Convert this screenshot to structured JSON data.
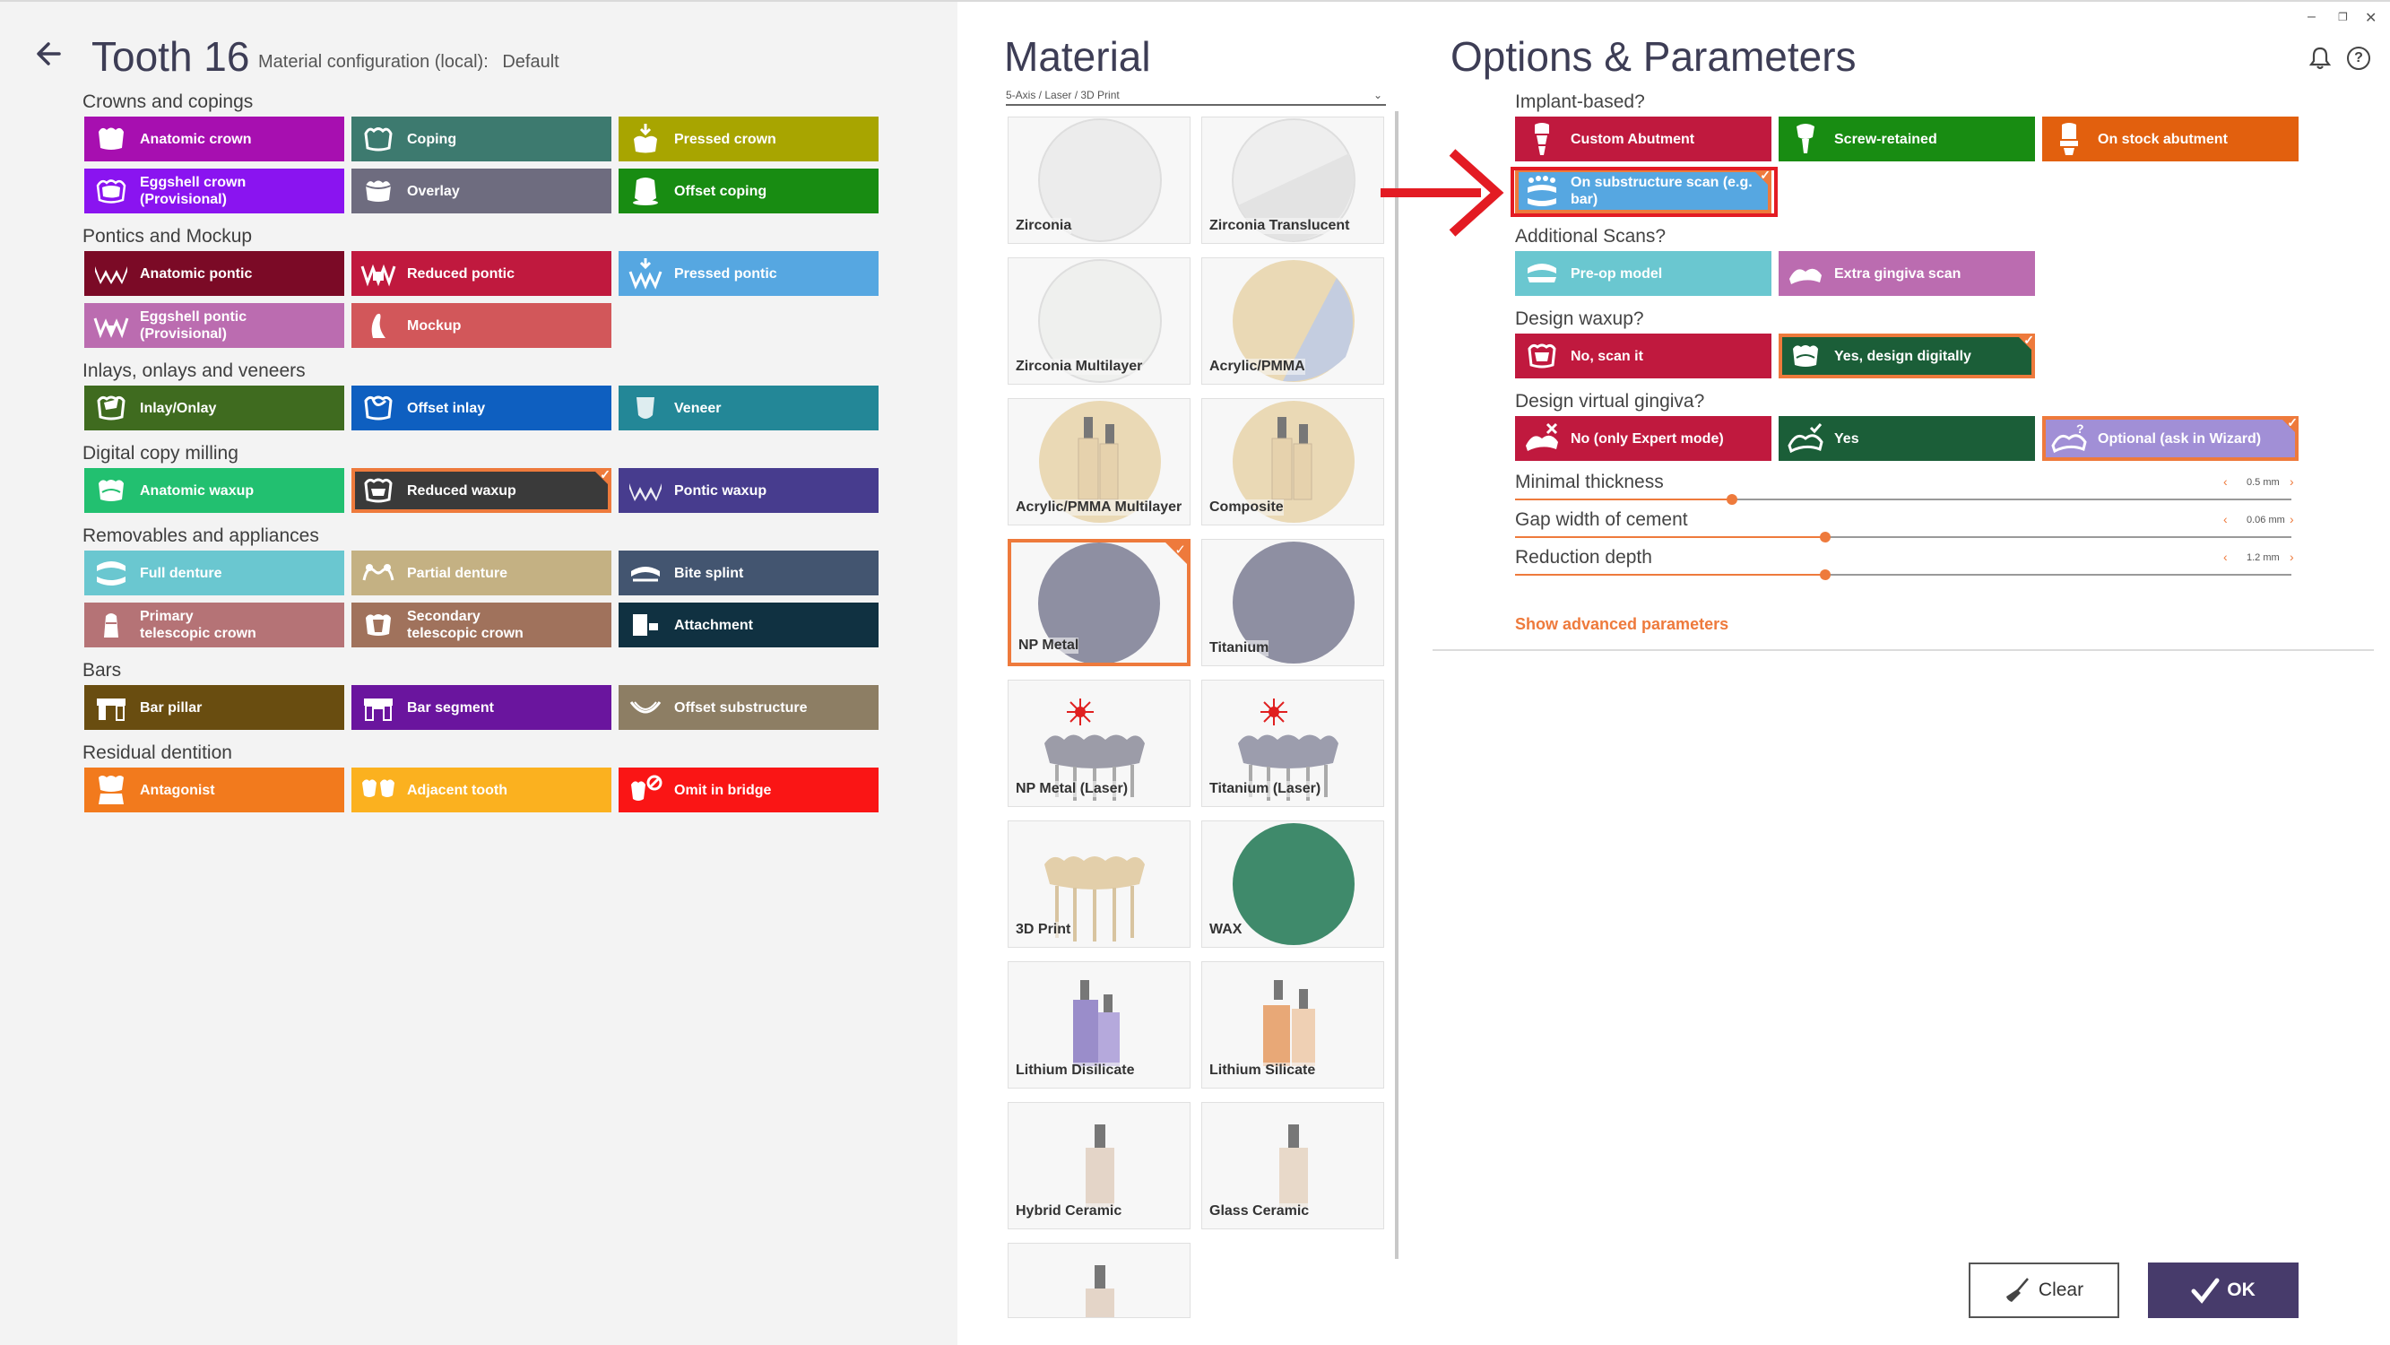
{
  "header": {
    "title": "Tooth 16",
    "material_config_label": "Material configuration (local):",
    "material_config_value": "Default"
  },
  "sections": [
    {
      "label": "Crowns and copings"
    },
    {
      "label": "Pontics and Mockup"
    },
    {
      "label": "Inlays, onlays and veneers"
    },
    {
      "label": "Digital copy milling"
    },
    {
      "label": "Removables and appliances"
    },
    {
      "label": "Bars"
    },
    {
      "label": "Residual dentition"
    }
  ],
  "tiles": {
    "anatomic_crown": {
      "label": "Anatomic crown",
      "color": "#a70fb0"
    },
    "coping": {
      "label": "Coping",
      "color": "#3d7a6f"
    },
    "pressed_crown": {
      "label": "Pressed crown",
      "color": "#a8a500"
    },
    "eggshell_crown": {
      "label": "Eggshell crown (Provisional)",
      "color": "#8a14f0"
    },
    "overlay": {
      "label": "Overlay",
      "color": "#6e6c7f"
    },
    "offset_coping": {
      "label": "Offset coping",
      "color": "#188c12"
    },
    "anatomic_pontic": {
      "label": "Anatomic pontic",
      "color": "#7b0a26"
    },
    "reduced_pontic": {
      "label": "Reduced pontic",
      "color": "#c0193e"
    },
    "pressed_pontic": {
      "label": "Pressed pontic",
      "color": "#56a7e1"
    },
    "eggshell_pontic": {
      "label": "Eggshell pontic (Provisional)",
      "color": "#bb6cb0"
    },
    "mockup": {
      "label": "Mockup",
      "color": "#d2575a"
    },
    "inlay_onlay": {
      "label": "Inlay/Onlay",
      "color": "#3f6b1f"
    },
    "offset_inlay": {
      "label": "Offset inlay",
      "color": "#0e5fc0"
    },
    "veneer": {
      "label": "Veneer",
      "color": "#238797"
    },
    "anatomic_waxup": {
      "label": "Anatomic waxup",
      "color": "#22c070"
    },
    "reduced_waxup": {
      "label": "Reduced waxup",
      "color": "#3a3a3a"
    },
    "pontic_waxup": {
      "label": "Pontic waxup",
      "color": "#473c8e"
    },
    "full_denture": {
      "label": "Full denture",
      "color": "#6ac7d0"
    },
    "partial_denture": {
      "label": "Partial denture",
      "color": "#c4b183"
    },
    "bite_splint": {
      "label": "Bite splint",
      "color": "#435570"
    },
    "primary_telescopic": {
      "label": "Primary telescopic crown",
      "color": "#b57376"
    },
    "secondary_telescopic": {
      "label": "Secondary telescopic crown",
      "color": "#a0725c"
    },
    "attachment": {
      "label": "Attachment",
      "color": "#103141"
    },
    "bar_pillar": {
      "label": "Bar pillar",
      "color": "#694d10"
    },
    "bar_segment": {
      "label": "Bar segment",
      "color": "#6a159e"
    },
    "offset_substructure": {
      "label": "Offset substructure",
      "color": "#8d7e64"
    },
    "antagonist": {
      "label": "Antagonist",
      "color": "#f27a1d"
    },
    "adjacent_tooth": {
      "label": "Adjacent tooth",
      "color": "#fbb11f"
    },
    "omit_in_bridge": {
      "label": "Omit in bridge",
      "color": "#fa1515"
    }
  },
  "material": {
    "title": "Material",
    "dropdown_value": "5-Axis / Laser / 3D Print",
    "items": [
      {
        "label": "Zirconia"
      },
      {
        "label": "Zirconia Translucent"
      },
      {
        "label": "Zirconia Multilayer"
      },
      {
        "label": "Acrylic/PMMA"
      },
      {
        "label": "Acrylic/PMMA Multilayer"
      },
      {
        "label": "Composite"
      },
      {
        "label": "NP Metal"
      },
      {
        "label": "Titanium"
      },
      {
        "label": "NP Metal (Laser)"
      },
      {
        "label": "Titanium (Laser)"
      },
      {
        "label": "3D Print"
      },
      {
        "label": "WAX"
      },
      {
        "label": "Lithium Disilicate"
      },
      {
        "label": "Lithium Silicate"
      },
      {
        "label": "Hybrid Ceramic"
      },
      {
        "label": "Glass Ceramic"
      },
      {
        "label": ""
      }
    ],
    "selected": "NP Metal"
  },
  "options": {
    "title": "Options & Parameters",
    "questions": {
      "implant": "Implant-based?",
      "scans": "Additional Scans?",
      "waxup": "Design waxup?",
      "gingiva": "Design virtual gingiva?"
    },
    "tiles": {
      "custom_abutment": {
        "label": "Custom Abutment",
        "color": "#c0193e"
      },
      "screw_retained": {
        "label": "Screw-retained",
        "color": "#188c12"
      },
      "stock_abutment": {
        "label": "On stock abutment",
        "color": "#e2600e"
      },
      "substructure_scan": {
        "label": "On substructure scan (e.g. bar)",
        "color": "#56a7e1"
      },
      "preop_model": {
        "label": "Pre-op model",
        "color": "#6ac7d0"
      },
      "extra_gingiva": {
        "label": "Extra gingiva scan",
        "color": "#bb6cb0"
      },
      "waxup_no": {
        "label": "No, scan it",
        "color": "#c0193e"
      },
      "waxup_yes": {
        "label": "Yes, design digitally",
        "color": "#1b5e38"
      },
      "gingiva_no": {
        "label": "No (only Expert mode)",
        "color": "#c0193e"
      },
      "gingiva_yes": {
        "label": "Yes",
        "color": "#1b5e38"
      },
      "gingiva_optional": {
        "label": "Optional (ask in Wizard)",
        "color": "#a18fd6"
      }
    },
    "sliders": [
      {
        "label": "Minimal thickness",
        "value": "0.5 mm",
        "fraction": 0.28
      },
      {
        "label": "Gap width of cement",
        "value": "0.06 mm",
        "fraction": 0.4
      },
      {
        "label": "Reduction depth",
        "value": "1.2 mm",
        "fraction": 0.4
      }
    ],
    "advanced_link": "Show advanced parameters"
  },
  "buttons": {
    "clear": "Clear",
    "ok": "OK"
  },
  "accent_color": "#ee7a3c",
  "highlight_color": "#e31b23"
}
